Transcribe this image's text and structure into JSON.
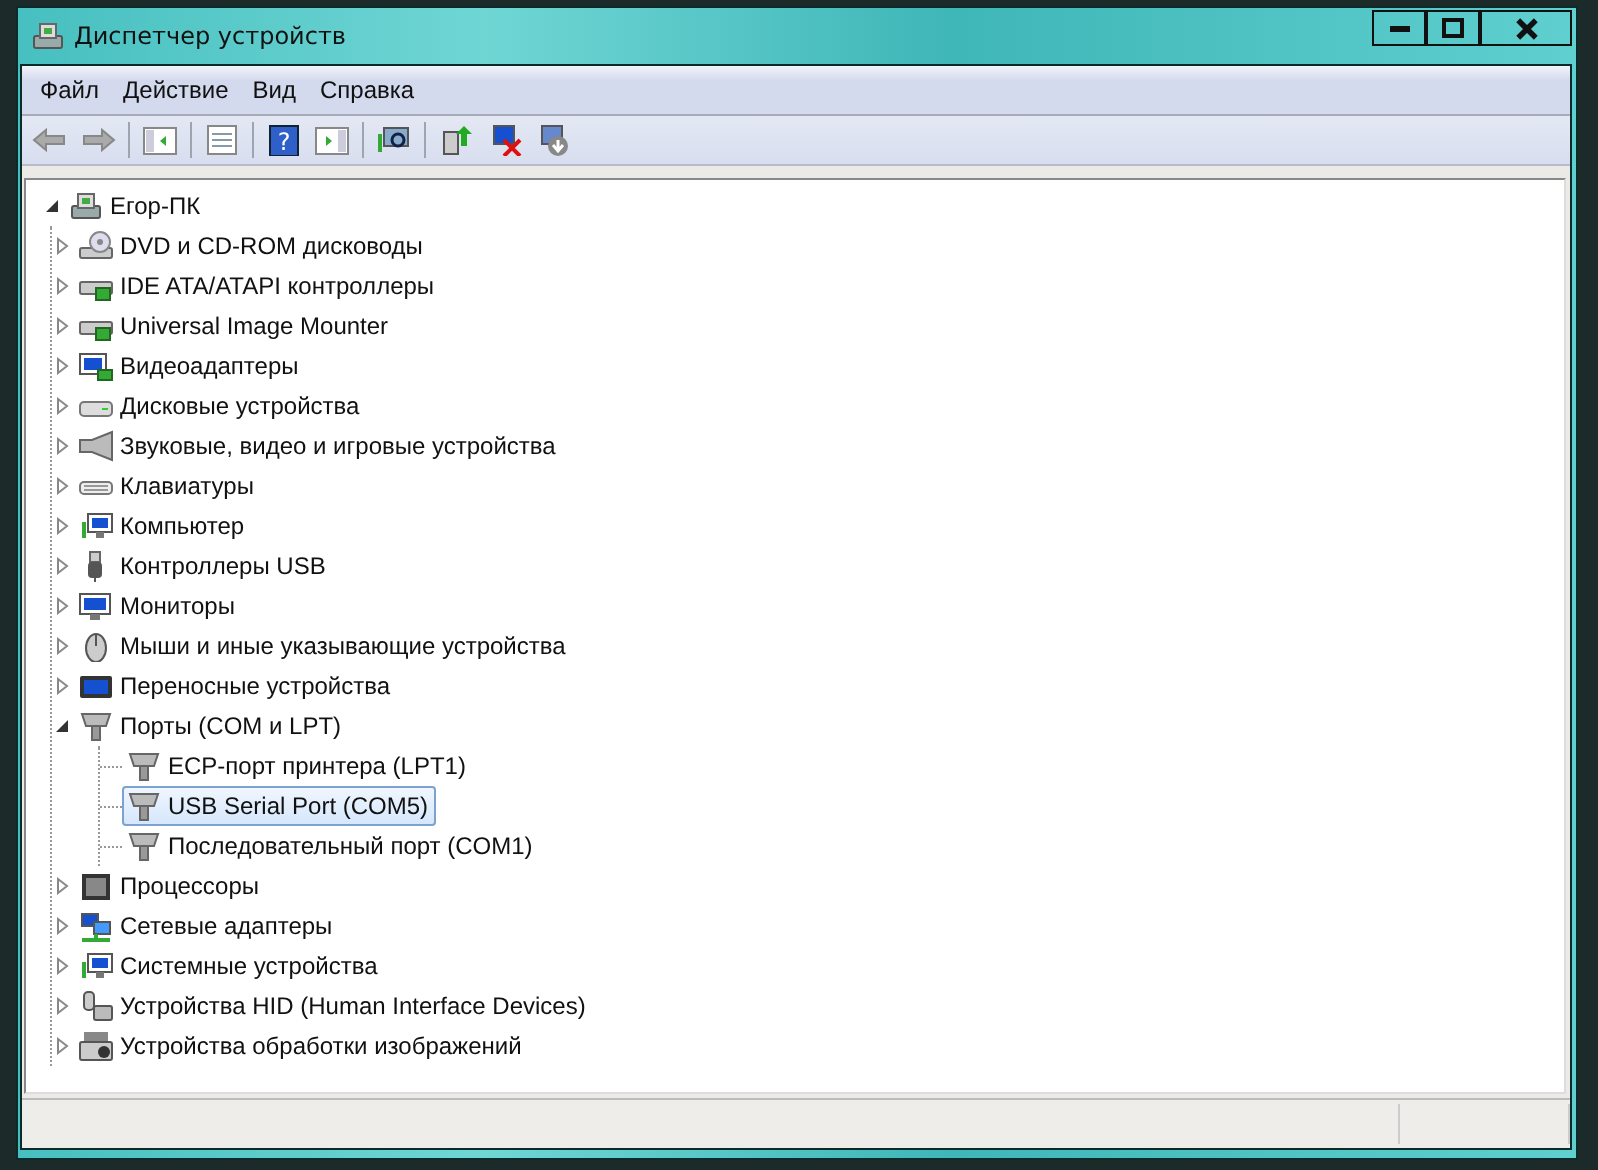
{
  "window": {
    "title": "Диспетчер устройств"
  },
  "menu": [
    {
      "label": "Файл"
    },
    {
      "label": "Действие"
    },
    {
      "label": "Вид"
    },
    {
      "label": "Справка"
    }
  ],
  "toolbar": {
    "help_label": "?"
  },
  "tree": {
    "label": "Егор-ПК",
    "kind": "computer",
    "expanded": true,
    "selected": false,
    "children": [
      {
        "label": "DVD и CD-ROM дисководы",
        "kind": "dvd",
        "expanded": false,
        "selected": false
      },
      {
        "label": "IDE ATA/ATAPI контроллеры",
        "kind": "controller",
        "expanded": false,
        "selected": false
      },
      {
        "label": "Universal Image Mounter",
        "kind": "controller",
        "expanded": false,
        "selected": false
      },
      {
        "label": "Видеоадаптеры",
        "kind": "display",
        "expanded": false,
        "selected": false
      },
      {
        "label": "Дисковые устройства",
        "kind": "drive",
        "expanded": false,
        "selected": false
      },
      {
        "label": "Звуковые, видео и игровые устройства",
        "kind": "speaker",
        "expanded": false,
        "selected": false
      },
      {
        "label": "Клавиатуры",
        "kind": "keyboard",
        "expanded": false,
        "selected": false
      },
      {
        "label": "Компьютер",
        "kind": "system",
        "expanded": false,
        "selected": false
      },
      {
        "label": "Контроллеры USB",
        "kind": "usb",
        "expanded": false,
        "selected": false
      },
      {
        "label": "Мониторы",
        "kind": "monitor",
        "expanded": false,
        "selected": false
      },
      {
        "label": "Мыши и иные указывающие устройства",
        "kind": "mouse",
        "expanded": false,
        "selected": false
      },
      {
        "label": "Переносные устройства",
        "kind": "portable",
        "expanded": false,
        "selected": false
      },
      {
        "label": "Порты (COM и LPT)",
        "kind": "port",
        "expanded": true,
        "selected": false,
        "children": [
          {
            "label": "ECP-порт принтера (LPT1)",
            "kind": "port",
            "selected": false
          },
          {
            "label": "USB Serial Port (COM5)",
            "kind": "port",
            "selected": true
          },
          {
            "label": "Последовательный порт (COM1)",
            "kind": "port",
            "selected": false
          }
        ]
      },
      {
        "label": "Процессоры",
        "kind": "cpu",
        "expanded": false,
        "selected": false
      },
      {
        "label": "Сетевые адаптеры",
        "kind": "network",
        "expanded": false,
        "selected": false
      },
      {
        "label": "Системные устройства",
        "kind": "system",
        "expanded": false,
        "selected": false
      },
      {
        "label": "Устройства HID (Human Interface Devices)",
        "kind": "hid",
        "expanded": false,
        "selected": false
      },
      {
        "label": "Устройства обработки изображений",
        "kind": "imaging",
        "expanded": false,
        "selected": false
      }
    ]
  }
}
